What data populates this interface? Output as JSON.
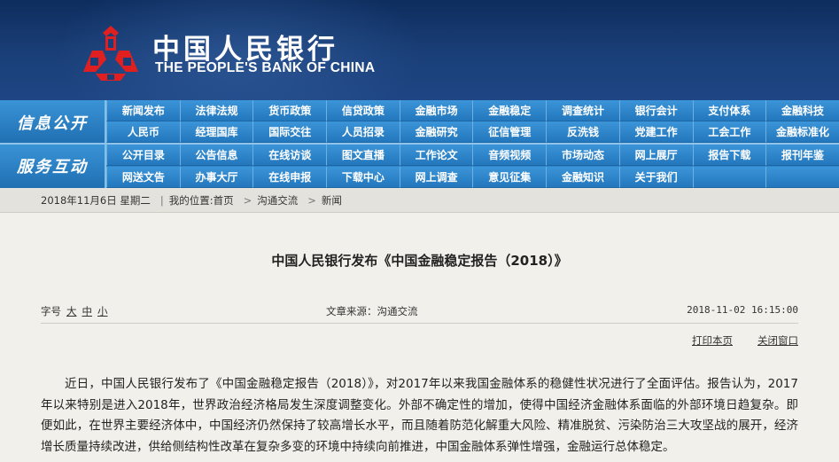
{
  "header": {
    "logo_cn": "中国人民银行",
    "logo_en": "THE PEOPLE'S BANK OF CHINA",
    "brand_red": "#e02020"
  },
  "nav": {
    "section1_label": "信息公开",
    "section2_label": "服务互动",
    "section1_items": [
      "新闻发布",
      "法律法规",
      "货币政策",
      "信贷政策",
      "金融市场",
      "金融稳定",
      "调查统计",
      "银行会计",
      "支付体系",
      "金融科技",
      "人民币",
      "经理国库",
      "国际交往",
      "人员招录",
      "金融研究",
      "征信管理",
      "反洗钱",
      "党建工作",
      "工会工作",
      "金融标准化"
    ],
    "section2_items": [
      "公开目录",
      "公告信息",
      "在线访谈",
      "图文直播",
      "工作论文",
      "音频视频",
      "市场动态",
      "网上展厅",
      "报告下载",
      "报刊年鉴",
      "网送文告",
      "办事大厅",
      "在线申报",
      "下载中心",
      "网上调查",
      "意见征集",
      "金融知识",
      "关于我们",
      "",
      ""
    ]
  },
  "breadcrumb": {
    "date": "2018年11月6日 星期二",
    "location_label": "我的位置:",
    "home": "首页",
    "level2": "沟通交流",
    "level3": "新闻"
  },
  "article": {
    "title": "中国人民银行发布《中国金融稳定报告（2018）》",
    "font_size_label": "字号",
    "size_large": "大",
    "size_medium": "中",
    "size_small": "小",
    "source": "文章来源：沟通交流",
    "datetime": "2018-11-02 16:15:00",
    "print_label": "打印本页",
    "close_label": "关闭窗口",
    "body": "近日，中国人民银行发布了《中国金融稳定报告（2018）》，对2017年以来我国金融体系的稳健性状况进行了全面评估。报告认为，2017年以来特别是进入2018年，世界政治经济格局发生深度调整变化。外部不确定性的增加，使得中国经济金融体系面临的外部环境日趋复杂。即便如此，在世界主要经济体中，中国经济仍然保持了较高增长水平，而且随着防范化解重大风险、精准脱贫、污染防治三大攻坚战的展开，经济增长质量持续改进，供给侧结构性改革在复杂多变的环境中持续向前推进，中国金融体系弹性增强，金融运行总体稳定。"
  }
}
